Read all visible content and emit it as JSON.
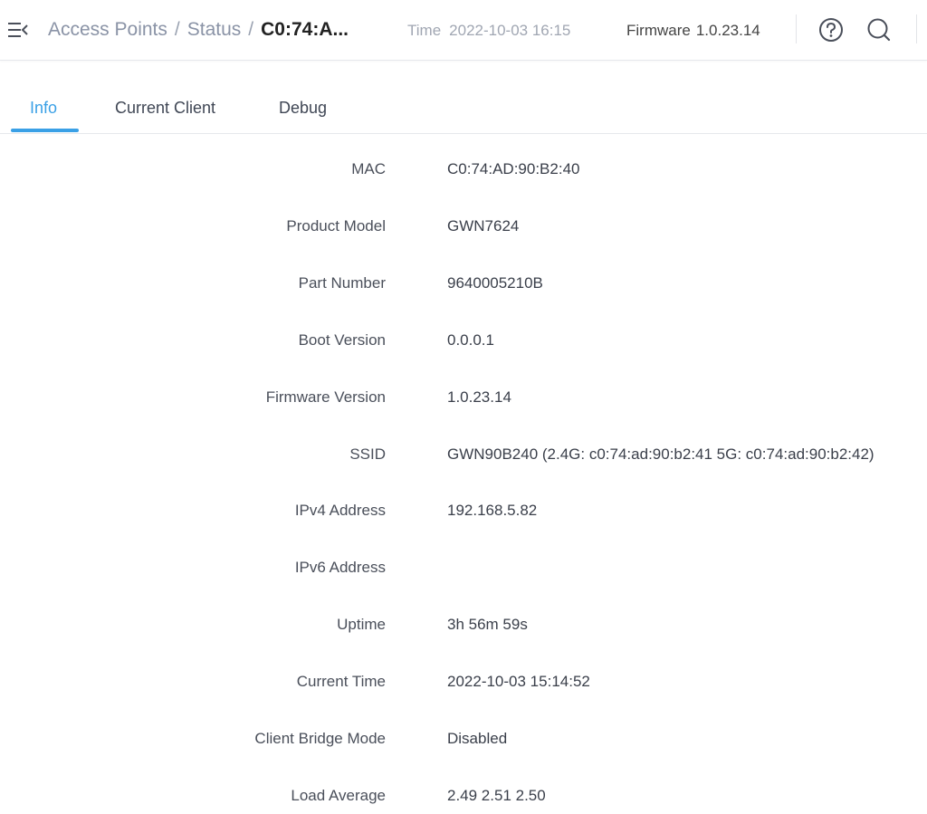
{
  "header": {
    "breadcrumb": {
      "items": [
        "Access Points",
        "Status"
      ],
      "separator": "/",
      "current": "C0:74:A..."
    },
    "time_label": "Time",
    "time_value": "2022-10-03 16:15",
    "firmware_label": "Firmware",
    "firmware_value": "1.0.23.14",
    "icons": [
      "menu-toggle-icon",
      "help-icon",
      "search-icon"
    ]
  },
  "tabs": {
    "items": [
      "Info",
      "Current Client",
      "Debug"
    ],
    "active": "Info"
  },
  "info": {
    "rows": [
      {
        "label": "MAC",
        "value": "C0:74:AD:90:B2:40"
      },
      {
        "label": "Product Model",
        "value": "GWN7624"
      },
      {
        "label": "Part Number",
        "value": "9640005210B"
      },
      {
        "label": "Boot Version",
        "value": "0.0.0.1"
      },
      {
        "label": "Firmware Version",
        "value": "1.0.23.14"
      },
      {
        "label": "SSID",
        "value": "GWN90B240 (2.4G: c0:74:ad:90:b2:41 5G: c0:74:ad:90:b2:42)"
      },
      {
        "label": "IPv4 Address",
        "value": "192.168.5.82"
      },
      {
        "label": "IPv6 Address",
        "value": ""
      },
      {
        "label": "Uptime",
        "value": "3h 56m 59s"
      },
      {
        "label": "Current Time",
        "value": "2022-10-03 15:14:52"
      },
      {
        "label": "Client Bridge Mode",
        "value": "Disabled"
      },
      {
        "label": "Load Average",
        "value": "2.49 2.51 2.50"
      }
    ]
  },
  "colors": {
    "accent": "#3aa0e6",
    "breadcrumb_link": "#8a93a6",
    "text": "#3a3f4a"
  }
}
